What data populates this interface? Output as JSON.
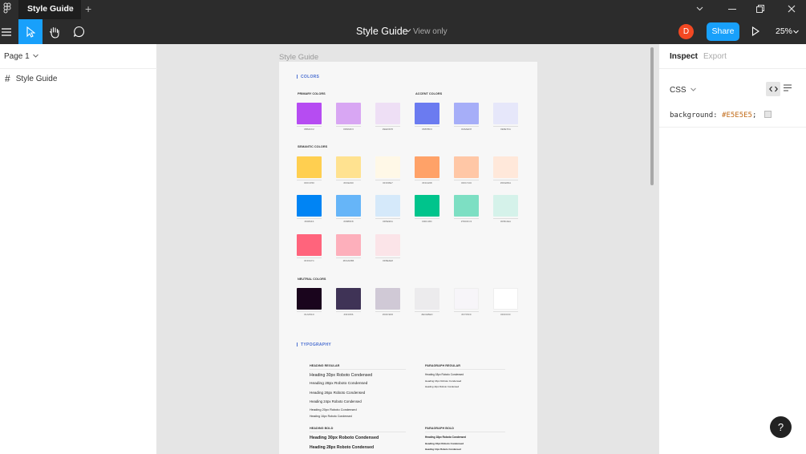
{
  "titlebar": {
    "tab_label": "Style Guide",
    "tab_close": "×",
    "new_tab": "+"
  },
  "toolbar": {
    "file_name": "Style Guide",
    "view_mode": "View only",
    "avatar_initial": "D",
    "share_label": "Share",
    "zoom": "25%"
  },
  "left_panel": {
    "page_selector": "Page 1",
    "frame_name": "Style Guide"
  },
  "canvas": {
    "frame_label": "Style Guide",
    "colors_title": "COLORS",
    "primary_label": "PRIMARY COLORS",
    "accent_label": "ACCENT COLORS",
    "semantic_label": "SEMANTIC COLORS",
    "neutral_label": "NEUTRAL COLORS",
    "primary": [
      {
        "color": "#B64CF2",
        "hex": "#B64CF2"
      },
      {
        "color": "#D8A6F3",
        "hex": "#D8A6F3"
      },
      {
        "color": "#EEDFF5",
        "hex": "#EEDFF5"
      }
    ],
    "accent": [
      {
        "color": "#6B7BF0",
        "hex": "#6B7BF0"
      },
      {
        "color": "#A6AEF8",
        "hex": "#A6AEF8"
      },
      {
        "color": "#E6E7FA",
        "hex": "#E6E7FA"
      }
    ],
    "semantic_row1": [
      {
        "color": "#FFCF50",
        "hex": "#FFCF50"
      },
      {
        "color": "#FFE290",
        "hex": "#FFE290"
      },
      {
        "color": "#FFF8E7",
        "hex": "#FFF8E7"
      },
      {
        "color": "#FFA268",
        "hex": "#FFA268"
      },
      {
        "color": "#FFC7A6",
        "hex": "#FFC7A6"
      },
      {
        "color": "#FFE8DA",
        "hex": "#FFE8DA"
      }
    ],
    "semantic_row2": [
      {
        "color": "#0084F4",
        "hex": "#0084F4"
      },
      {
        "color": "#66B5F8",
        "hex": "#66B5F8"
      },
      {
        "color": "#D5E9FA",
        "hex": "#D5E9FA"
      },
      {
        "color": "#00C48C",
        "hex": "#00C48C"
      },
      {
        "color": "#7DDFC3",
        "hex": "#7DDFC3"
      },
      {
        "color": "#D5F2EA",
        "hex": "#D5F2EA"
      }
    ],
    "semantic_row3": [
      {
        "color": "#FF647C",
        "hex": "#FF647C"
      },
      {
        "color": "#FDAFBB",
        "hex": "#FDAFBB"
      },
      {
        "color": "#FBE4E8",
        "hex": "#FBE4E8"
      }
    ],
    "neutral": [
      {
        "color": "#1A051D",
        "hex": "#1A051D"
      },
      {
        "color": "#3F3356",
        "hex": "#3F3356"
      },
      {
        "color": "#D0C9D6",
        "hex": "#D0C9D6"
      },
      {
        "color": "#ECEBED",
        "hex": "#ECEBED"
      },
      {
        "color": "#F7F5F9",
        "hex": "#F7F5F9"
      },
      {
        "color": "#FFFFFF",
        "hex": "#FFFFFF"
      }
    ],
    "typography_title": "TYPOGRAPHY",
    "heading_regular_label": "HEADING REGULAR",
    "paragraph_regular_label": "PARAGRAPH REGULAR",
    "heading_bold_label": "HEADING BOLD",
    "paragraph_bold_label": "PARAGRAPH BOLD",
    "heading_regular": [
      "Heading 30px Roboto Condensed",
      "Heading 28px Roboto Condensed",
      "Heading 26px Roboto Condensed",
      "Heading 24px Roboto Condensed",
      "Heading 20px Roboto Condensed",
      "Heading 16px Roboto Condensed"
    ],
    "paragraph_regular": [
      "Heading 18px Roboto Condensed",
      "Heading 16px Roboto Condensed",
      "Heading 14px Roboto Condensed"
    ],
    "heading_bold": [
      "Heading 30px Roboto Condensed",
      "Heading 28px Roboto Condensed"
    ],
    "paragraph_bold": [
      "Heading 18px Roboto Condensed",
      "Heading 16px Roboto Condensed",
      "Heading 14px Roboto Condensed"
    ]
  },
  "right_panel": {
    "tab_inspect": "Inspect",
    "tab_export": "Export",
    "lang": "CSS",
    "prop": "background:",
    "value": "#E5E5E5",
    "semicolon": ";"
  },
  "help_label": "?"
}
